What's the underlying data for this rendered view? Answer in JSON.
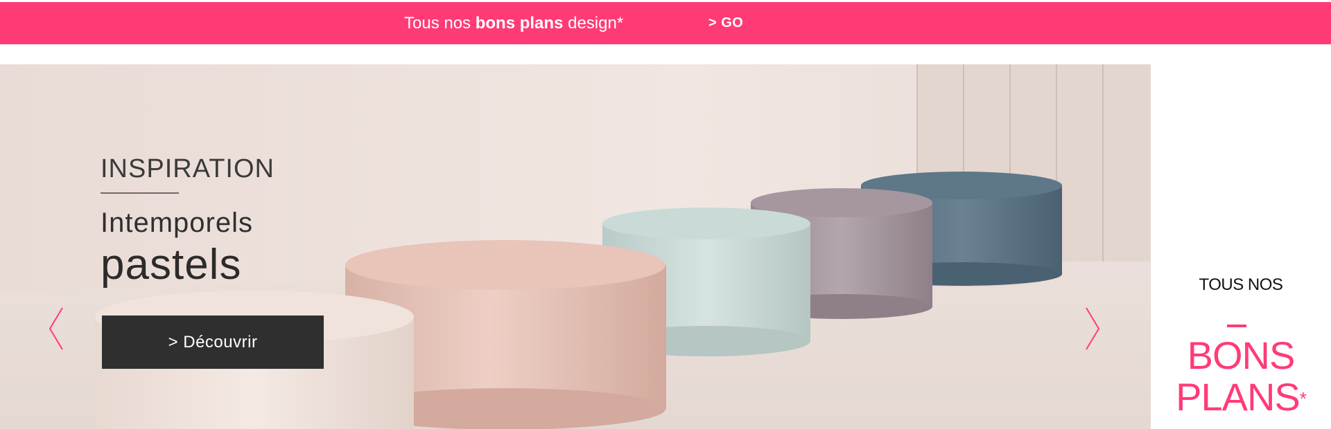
{
  "promo_bar": {
    "text_prefix": "Tous nos ",
    "text_bold": "bons plans",
    "text_suffix": " design*",
    "go_label": "> GO",
    "color": "#ff3b76"
  },
  "hero": {
    "eyebrow": "INSPIRATION",
    "line1": "Intemporels",
    "line2": "pastels",
    "cta_label": "> Découvrir",
    "prev_icon": "chevron-left-icon",
    "next_icon": "chevron-right-icon",
    "pouf_colors": [
      "#f1e4dc",
      "#e8c6bb",
      "#cddcd9",
      "#a999a0",
      "#5f788a"
    ]
  },
  "side_promo": {
    "line1": "TOUS NOS",
    "line2": "BONS",
    "line3": "PLANS",
    "asterisk": "*",
    "accent": "#ff3b76"
  }
}
